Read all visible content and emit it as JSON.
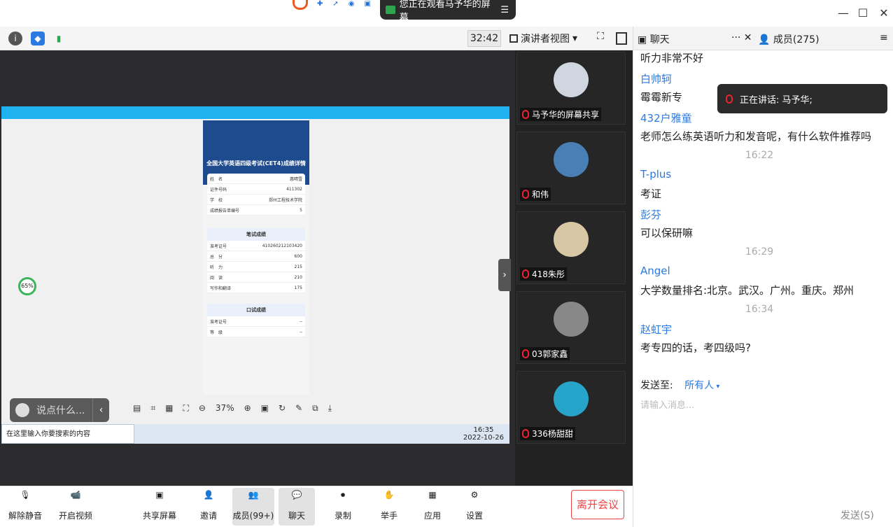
{
  "titlebar": {
    "banner": "您正在观看马予华的屏幕"
  },
  "toolbar": {
    "timer": "32:42",
    "view_label": "演讲者视图"
  },
  "remote": {
    "phone_title": "全国大学英语四级考试(CET4)成绩详情",
    "profile": [
      {
        "k": "姓　名",
        "v": "惠晴雪"
      },
      {
        "k": "证件号码",
        "v": "411302"
      },
      {
        "k": "学　校",
        "v": "郑州工程技术学院"
      },
      {
        "k": "成绩报告单编号",
        "v": "5"
      }
    ],
    "written_title": "笔试成绩",
    "written": [
      {
        "k": "准考证号",
        "v": "410260212103420"
      },
      {
        "k": "总　分",
        "v": "600"
      },
      {
        "k": "听　力",
        "v": "215"
      },
      {
        "k": "阅　读",
        "v": "210"
      },
      {
        "k": "写作和翻译",
        "v": "175"
      }
    ],
    "oral_title": "口试成绩",
    "oral": [
      {
        "k": "准考证号",
        "v": "--"
      },
      {
        "k": "等　级",
        "v": "--"
      }
    ],
    "zoom": "37%",
    "taskbar_search": "在这里输入你要搜索的内容",
    "taskbar_time": "16:35",
    "taskbar_date": "2022-10-26",
    "progress_value": "65%",
    "say_placeholder": "说点什么..."
  },
  "gallery": [
    {
      "label": "马予华的屏幕共享",
      "color": "#cfd6e0"
    },
    {
      "label": "和伟",
      "color": "#4a7fb5"
    },
    {
      "label": "418朱彤",
      "color": "#d8c7a5"
    },
    {
      "label": "03郭家鑫",
      "color": "#888"
    },
    {
      "label": "336杨甜甜",
      "color": "#26a4c9"
    }
  ],
  "chat": {
    "tab_chat": "聊天",
    "tab_members": "成员(275)",
    "speaking": "正在讲话: 马予华;",
    "messages": [
      {
        "type": "text",
        "text": "听力非常不好"
      },
      {
        "type": "name",
        "text": "白帅轲"
      },
      {
        "type": "text",
        "text": "霉霉新专"
      },
      {
        "type": "name",
        "text": "432户雅童"
      },
      {
        "type": "text",
        "text": "老师怎么练英语听力和发音呢，有什么软件推荐吗"
      },
      {
        "type": "ts",
        "text": "16:22"
      },
      {
        "type": "name",
        "text": "T-plus"
      },
      {
        "type": "text",
        "text": "考证"
      },
      {
        "type": "name",
        "text": "彭芬"
      },
      {
        "type": "text",
        "text": "可以保研嘛"
      },
      {
        "type": "ts",
        "text": "16:29"
      },
      {
        "type": "name",
        "text": "Angel"
      },
      {
        "type": "text",
        "text": "大学数量排名:北京。武汉。广州。重庆。郑州"
      },
      {
        "type": "ts",
        "text": "16:34"
      },
      {
        "type": "name",
        "text": "赵虹宇"
      },
      {
        "type": "text",
        "text": "考专四的话，考四级吗?"
      }
    ],
    "send_to_label": "发送至:",
    "send_to_value": "所有人",
    "placeholder": "请输入消息...",
    "send_button": "发送(S)"
  },
  "bottom": {
    "unmute": "解除静音",
    "video": "开启视频",
    "share": "共享屏幕",
    "invite": "邀请",
    "members": "成员(99+)",
    "chat": "聊天",
    "record": "录制",
    "raise": "举手",
    "apps": "应用",
    "settings": "设置",
    "leave": "离开会议"
  }
}
